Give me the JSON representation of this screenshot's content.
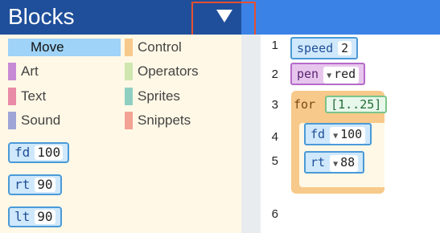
{
  "header": {
    "title": "Blocks",
    "toggle_icon": "chevron-down-icon"
  },
  "palette": {
    "categories": [
      {
        "label": "Move",
        "color": "#9fd3f7",
        "selected": true
      },
      {
        "label": "Control",
        "color": "#f7c98a"
      },
      {
        "label": "Art",
        "color": "#c78bd6"
      },
      {
        "label": "Operators",
        "color": "#cfe6b0"
      },
      {
        "label": "Text",
        "color": "#e98ba6"
      },
      {
        "label": "Sprites",
        "color": "#8fcfc2"
      },
      {
        "label": "Sound",
        "color": "#9fa5d6"
      },
      {
        "label": "Snippets",
        "color": "#f3a394"
      }
    ],
    "blocks": [
      {
        "cmd": "fd",
        "arg": "100"
      },
      {
        "cmd": "rt",
        "arg": "90"
      },
      {
        "cmd": "lt",
        "arg": "90"
      }
    ]
  },
  "editor": {
    "line_numbers": [
      "1",
      "2",
      "3",
      "4",
      "5",
      "6"
    ],
    "speed": {
      "cmd": "speed",
      "arg": "2"
    },
    "pen": {
      "cmd": "pen",
      "arg": "red"
    },
    "for": {
      "cmd": "for",
      "range": "[1..25]"
    },
    "fd": {
      "cmd": "fd",
      "arg": "100"
    },
    "rt": {
      "cmd": "rt",
      "arg": "88"
    }
  }
}
